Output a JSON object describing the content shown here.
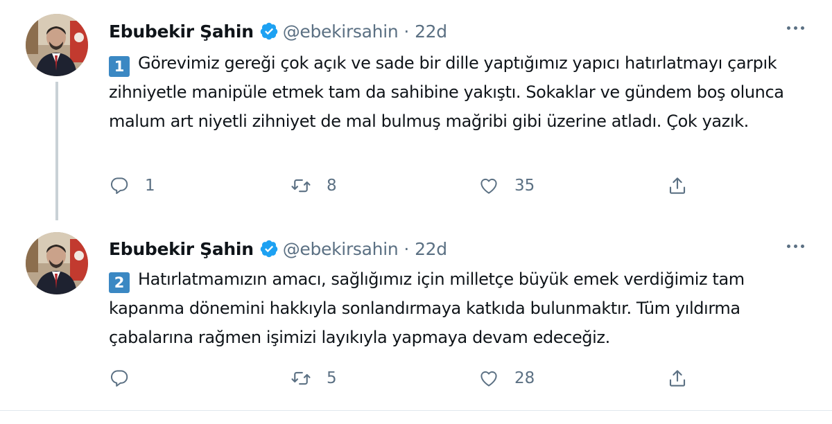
{
  "colors": {
    "accent": "#1da1f2",
    "secondary_text": "#5b7083",
    "primary_text": "#0f1419",
    "number_badge": "#3b88c3"
  },
  "tweets": [
    {
      "author": "Ebubekir Şahin",
      "verified": true,
      "handle": "@ebekirsahin",
      "separator": "·",
      "time": "22d",
      "badge": "1",
      "text": "Görevimiz gereği çok açık ve sade bir dille yaptığımız yapıcı hatırlatmayı çarpık zihniyetle manipüle etmek tam da sahibine yakıştı. Sokaklar ve gündem boş olunca malum art niyetli zihniyet de mal bulmuş mağribi gibi üzerine atladı. Çok yazık.",
      "replies": "1",
      "retweets": "8",
      "likes": "35",
      "icons": [
        "reply-icon",
        "retweet-icon",
        "like-icon",
        "share-icon"
      ]
    },
    {
      "author": "Ebubekir Şahin",
      "verified": true,
      "handle": "@ebekirsahin",
      "separator": "·",
      "time": "22d",
      "badge": "2",
      "text": "Hatırlatmamızın amacı, sağlığımız için milletçe büyük emek verdiğimiz tam kapanma dönemini hakkıyla sonlandırmaya katkıda bulunmaktır. Tüm yıldırma çabalarına rağmen işimizi layıkıyla yapmaya devam edeceğiz.",
      "replies": "",
      "retweets": "5",
      "likes": "28",
      "icons": [
        "reply-icon",
        "retweet-icon",
        "like-icon",
        "share-icon"
      ]
    }
  ]
}
